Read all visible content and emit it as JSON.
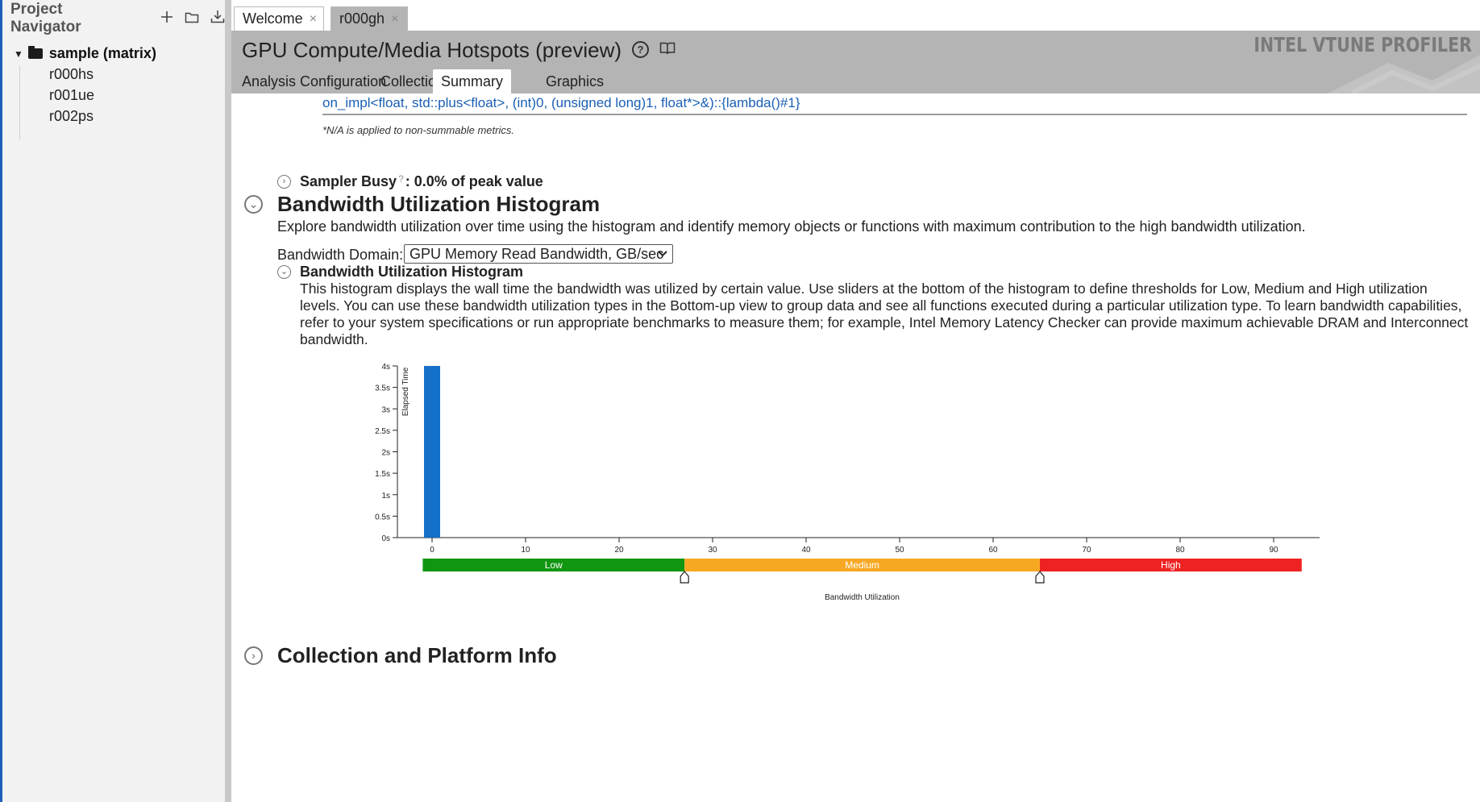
{
  "navigator": {
    "title": "Project Navigator",
    "tools": [
      "plus-icon",
      "folder-icon",
      "import-icon"
    ],
    "project": "sample (matrix)",
    "results": [
      "r000hs",
      "r001ue",
      "r002ps"
    ]
  },
  "tabs": [
    {
      "label": "Welcome",
      "close": "×"
    },
    {
      "label": "r000gh",
      "close": "×"
    }
  ],
  "header": {
    "title": "GPU Compute/Media Hotspots (preview)",
    "help_glyph": "?",
    "brand": "INTEL VTUNE PROFILER",
    "analysis_tabs": [
      "Analysis Configuration",
      "Collection Log",
      "Summary",
      "Graphics"
    ],
    "active_tab": "Summary"
  },
  "colors": {
    "accent": "#1f5fb8",
    "header_bg": "#b4b4b4",
    "bar": "#1470c8",
    "low": "#119611",
    "medium": "#f7a823",
    "high": "#ee2222",
    "link": "#1a5fb4"
  },
  "content": {
    "function_link": "on_impl<float, std::plus<float>, (int)0, (unsigned long)1, float*>&)::{lambda()#1}",
    "na_note": "*N/A is applied to non-summable metrics.",
    "sampler_label": "Sampler Busy",
    "sampler_q": "?",
    "sampler_value": ": 0.0% of peak value",
    "bw_title": "Bandwidth Utilization Histogram",
    "bw_desc": "Explore bandwidth utilization over time using the histogram and identify memory objects or functions with maximum contribution to the high bandwidth utilization.",
    "domain_label": "Bandwidth Domain:",
    "domain_value": "GPU Memory Read Bandwidth, GB/sec",
    "sub_title": "Bandwidth Utilization Histogram",
    "sub_desc": "This histogram displays the wall time the bandwidth was utilized by certain value. Use sliders at the bottom of the histogram to define thresholds for Low, Medium and High utilization levels. You can use these bandwidth utilization types in the Bottom-up view to group data and see all functions executed during a particular utilization type. To learn bandwidth capabilities, refer to your system specifications or run appropriate benchmarks to measure them; for example, Intel Memory Latency Checker can provide maximum achievable DRAM and Interconnect bandwidth.",
    "ci_title": "Collection and Platform Info"
  },
  "chart_data": {
    "type": "bar",
    "xlabel": "Bandwidth Utilization",
    "ylabel": "Elapsed Time",
    "x_ticks": [
      0,
      10,
      20,
      30,
      40,
      50,
      60,
      70,
      80,
      90
    ],
    "y_ticks": [
      "0s",
      "0.5s",
      "1s",
      "1.5s",
      "2s",
      "2.5s",
      "3s",
      "3.5s",
      "4s"
    ],
    "xlim": [
      -1,
      95
    ],
    "ylim": [
      0,
      4
    ],
    "bars": [
      {
        "x": 0,
        "width": 1.5,
        "value": 4.0
      }
    ],
    "thresholds": [
      {
        "label": "Low",
        "from": -1,
        "to": 27
      },
      {
        "label": "Medium",
        "from": 27,
        "to": 65
      },
      {
        "label": "High",
        "from": 65,
        "to": 93
      }
    ],
    "sliders": [
      27,
      65
    ]
  }
}
